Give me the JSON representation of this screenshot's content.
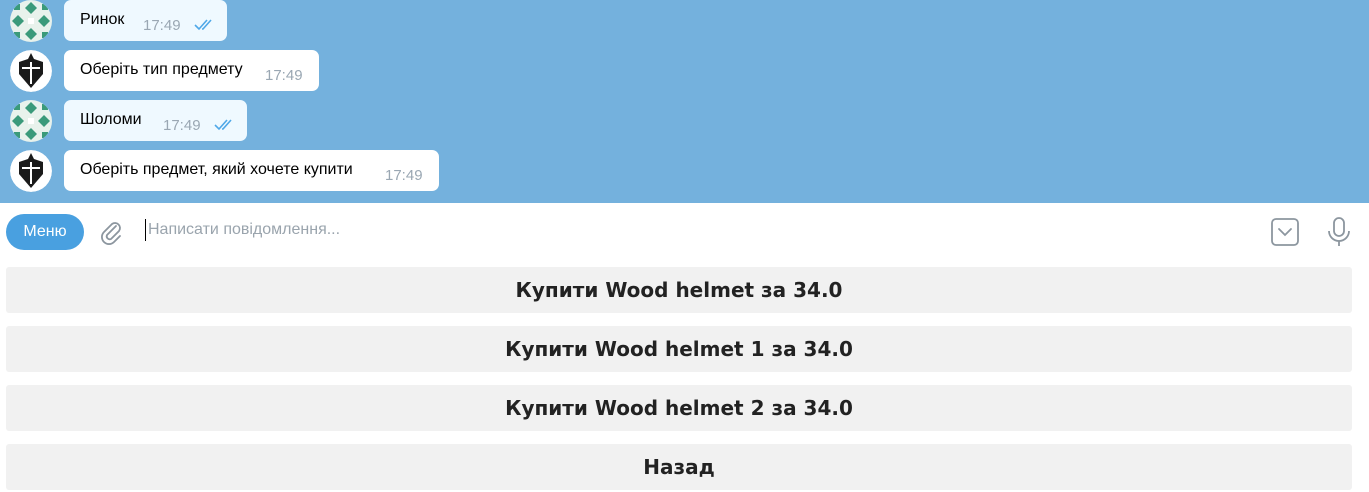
{
  "messages": [
    {
      "text": "Ринок",
      "time": "17:49",
      "direction": "out",
      "read": true
    },
    {
      "text": "Оберіть тип предмету",
      "time": "17:49",
      "direction": "in",
      "read": false
    },
    {
      "text": "Шоломи",
      "time": "17:49",
      "direction": "out",
      "read": true
    },
    {
      "text": "Оберіть предмет, який хочете купити",
      "time": "17:49",
      "direction": "in",
      "read": false
    }
  ],
  "composer": {
    "menu_label": "Меню",
    "placeholder": "Написати повідомлення..."
  },
  "keyboard": {
    "buttons": [
      "Купити Wood helmet за 34.0",
      "Купити Wood helmet 1 за 34.0",
      "Купити Wood helmet 2 за 34.0",
      "Назад"
    ]
  },
  "colors": {
    "chat_background": "#74b1dd",
    "menu_button": "#49a0e0",
    "read_checks": "#4fa8e8",
    "keyboard_button": "#f1f1f1"
  },
  "icons": {
    "user_avatar": "pattern-avatar-icon",
    "bot_avatar": "knight-helmet-avatar-icon",
    "attach": "paperclip-icon",
    "keyboard": "keyboard-toggle-icon",
    "mic": "microphone-icon",
    "read": "double-check-icon"
  }
}
